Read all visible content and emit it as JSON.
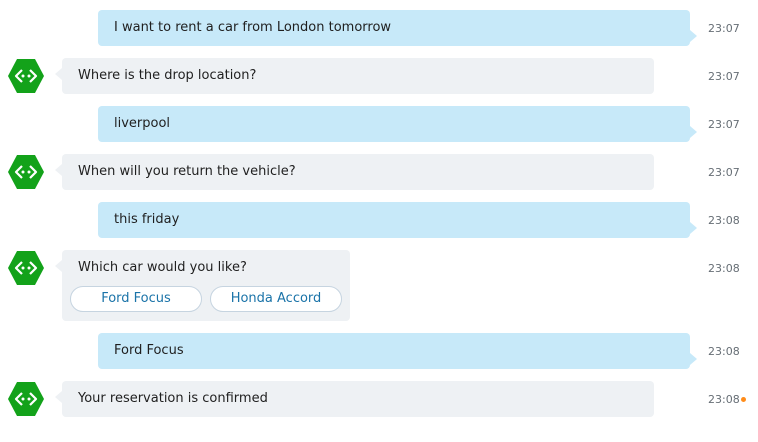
{
  "colors": {
    "user_bubble": "#c7e9f9",
    "bot_bubble": "#eef1f4",
    "avatar": "#13a21a",
    "choice_text": "#1a73a8",
    "unread_dot": "#ff8c1a"
  },
  "bot": {
    "avatar_icon": "bot-hexagon-icon"
  },
  "messages": [
    {
      "sender": "user",
      "text": "I want to rent a car from London tomorrow",
      "time": "23:07"
    },
    {
      "sender": "bot",
      "text": "Where is the drop location?",
      "time": "23:07"
    },
    {
      "sender": "user",
      "text": "liverpool",
      "time": "23:07"
    },
    {
      "sender": "bot",
      "text": "When will you return the vehicle?",
      "time": "23:07"
    },
    {
      "sender": "user",
      "text": "this friday",
      "time": "23:08"
    },
    {
      "sender": "bot",
      "text": "Which car would you like?",
      "time": "23:08",
      "choices": [
        "Ford Focus",
        "Honda Accord"
      ]
    },
    {
      "sender": "user",
      "text": "Ford Focus",
      "time": "23:08"
    },
    {
      "sender": "bot",
      "text": "Your reservation is confirmed",
      "time": "23:08",
      "unread": true
    }
  ]
}
